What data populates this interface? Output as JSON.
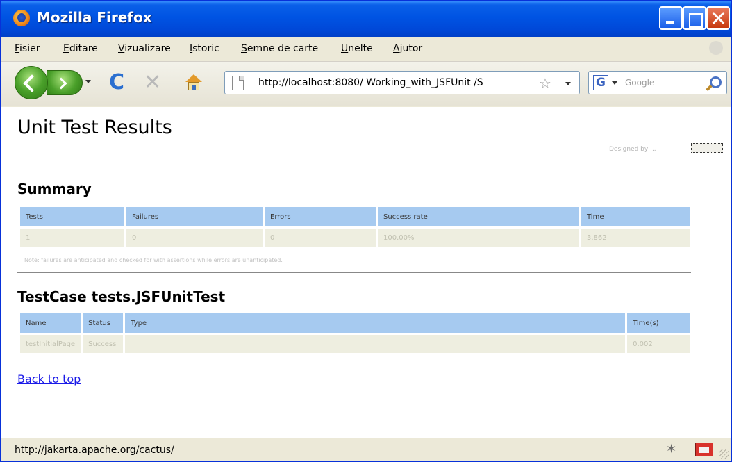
{
  "window": {
    "title": "Mozilla Firefox"
  },
  "menu": [
    {
      "key": "F",
      "rest": "isier"
    },
    {
      "key": "E",
      "rest": "ditare"
    },
    {
      "key": "V",
      "rest": "izualizare"
    },
    {
      "key": "I",
      "rest": "storic"
    },
    {
      "key": "S",
      "rest": "emne de carte"
    },
    {
      "key": "U",
      "rest": "nelte"
    },
    {
      "key": "A",
      "rest": "jutor"
    }
  ],
  "toolbar": {
    "url": "http://localhost:8080/ Working_with_JSFUnit /S",
    "search_placeholder": "Google",
    "search_engine_letter": "G"
  },
  "page": {
    "title": "Unit Test Results",
    "designed_by": "Designed by ...",
    "summary": {
      "heading": "Summary",
      "columns": [
        "Tests",
        "Failures",
        "Errors",
        "Success rate",
        "Time"
      ],
      "row": [
        "1",
        "0",
        "0",
        "100.00%",
        "3.862"
      ],
      "note": "Note: failures are anticipated and checked for with assertions while errors are unanticipated."
    },
    "testcase": {
      "heading": "TestCase tests.JSFUnitTest",
      "columns": [
        "Name",
        "Status",
        "Type",
        "Time(s)"
      ],
      "row": [
        "testInitialPage",
        "Success",
        "",
        "0.002"
      ]
    },
    "back_to_top": "Back to top"
  },
  "status": {
    "text": "http://jakarta.apache.org/cactus/"
  },
  "icons": [
    "firefox-icon",
    "back-icon",
    "forward-icon",
    "reload-icon",
    "stop-icon",
    "home-icon",
    "page-icon",
    "star-icon",
    "google-icon",
    "search-icon",
    "bug-icon",
    "addon-icon"
  ]
}
